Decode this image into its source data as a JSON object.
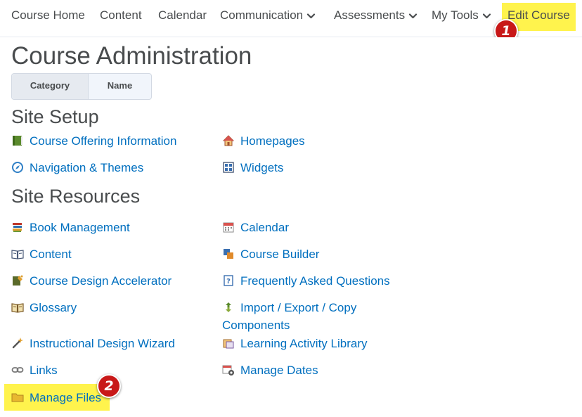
{
  "nav": {
    "items": [
      {
        "label": "Course Home"
      },
      {
        "label": "Content"
      },
      {
        "label": "Calendar"
      },
      {
        "label": "Communication"
      },
      {
        "label": "Assessments"
      },
      {
        "label": "My Tools"
      },
      {
        "label": "Edit Course"
      }
    ]
  },
  "badges": {
    "one": "1",
    "two": "2"
  },
  "page": {
    "title": "Course Administration",
    "toggle": {
      "category": "Category",
      "name": "Name"
    }
  },
  "site_setup": {
    "title": "Site Setup",
    "links": [
      {
        "label": "Course Offering Information",
        "icon": "book-icon"
      },
      {
        "label": "Homepages",
        "icon": "house-icon"
      },
      {
        "label": "Navigation & Themes",
        "icon": "compass-icon"
      },
      {
        "label": "Widgets",
        "icon": "widgets-grid-icon"
      }
    ]
  },
  "site_resources": {
    "title": "Site Resources",
    "links": [
      {
        "label": "Book Management",
        "icon": "books-stack-icon"
      },
      {
        "label": "Calendar",
        "icon": "calendar-icon"
      },
      {
        "label": "Content",
        "icon": "open-book-icon"
      },
      {
        "label": "Course Builder",
        "icon": "course-builder-icon"
      },
      {
        "label": "Course Design Accelerator",
        "icon": "design-accelerator-icon"
      },
      {
        "label": "Frequently Asked Questions",
        "icon": "faq-icon"
      },
      {
        "label": "Glossary",
        "icon": "glossary-icon"
      },
      {
        "label": "Import / Export / Copy Components",
        "icon": "import-export-icon"
      },
      {
        "label": "Instructional Design Wizard",
        "icon": "wand-icon"
      },
      {
        "label": "Learning Activity Library",
        "icon": "activity-library-icon"
      },
      {
        "label": "Links",
        "icon": "chain-link-icon"
      },
      {
        "label": "Manage Dates",
        "icon": "manage-dates-icon"
      },
      {
        "label": "Manage Files",
        "icon": "folder-icon"
      }
    ]
  },
  "colors": {
    "link": "#006fbf",
    "highlight": "#fff34d",
    "badge": "#c81818",
    "text": "#494c4e"
  }
}
